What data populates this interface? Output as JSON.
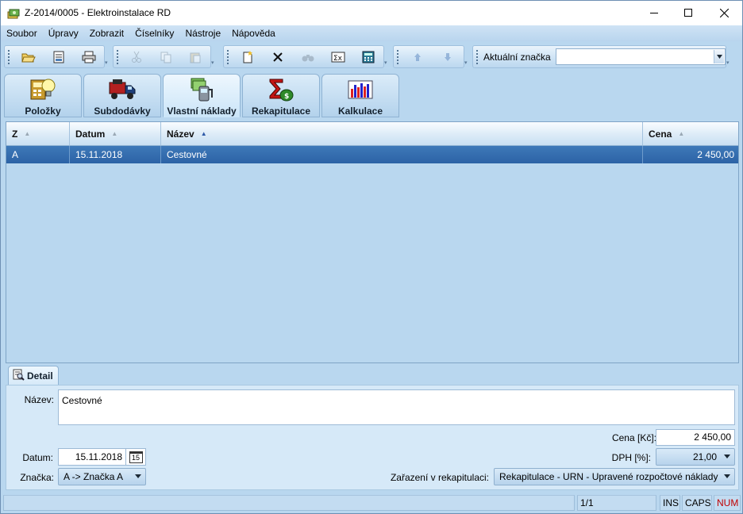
{
  "window": {
    "title": "Z-2014/0005 - Elektroinstalace RD"
  },
  "menu": {
    "items": [
      "Soubor",
      "Úpravy",
      "Zobrazit",
      "Číselníky",
      "Nástroje",
      "Nápověda"
    ]
  },
  "toolbar": {
    "marker_label": "Aktuální značka",
    "marker_value": ""
  },
  "tabs": [
    {
      "label": "Položky",
      "icon": "bulb-icon"
    },
    {
      "label": "Subdodávky",
      "icon": "truck-icon"
    },
    {
      "label": "Vlastní náklady",
      "icon": "money-pump-icon"
    },
    {
      "label": "Rekapitulace",
      "icon": "sigma-icon"
    },
    {
      "label": "Kalkulace",
      "icon": "bar-chart-icon"
    }
  ],
  "grid": {
    "columns": [
      "Z",
      "Datum",
      "Název",
      "Cena"
    ],
    "rows": [
      {
        "z": "A",
        "datum": "15.11.2018",
        "nazev": "Cestovné",
        "cena": "2 450,00"
      }
    ]
  },
  "detail": {
    "tab_label": "Detail",
    "nazev_label": "Název:",
    "nazev_value": "Cestovné",
    "datum_label": "Datum:",
    "datum_value": "15.11.2018",
    "calendar_day": "15",
    "znacka_label": "Značka:",
    "znacka_value": "A  ->  Značka A",
    "cena_label": "Cena [Kč]:",
    "cena_value": "2 450,00",
    "dph_label": "DPH [%]:",
    "dph_value": "21,00",
    "zarazeni_label": "Zařazení v rekapitulaci:",
    "zarazeni_value": "Rekapitulace - URN - Upravené rozpočtové náklady"
  },
  "status": {
    "record": "1/1",
    "ins": "INS",
    "caps": "CAPS",
    "num": "NUM"
  },
  "colors": {
    "accent": "#2c63a6",
    "num_indicator": "#c00000"
  }
}
